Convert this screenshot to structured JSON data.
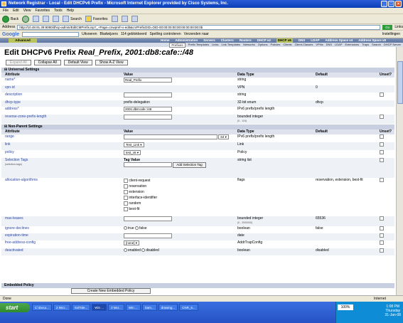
{
  "window": {
    "title": "Network Registrar - Local - Edit DHCPv6 Prefix - Microsoft Internet Explorer provided by Cisco Systems, Inc."
  },
  "menu": [
    "File",
    "Edit",
    "View",
    "Favorites",
    "Tools",
    "Help"
  ],
  "toolbar": {
    "back": "Back",
    "search": "Search",
    "favorites": "Favorites"
  },
  "address": {
    "label": "Address",
    "url": "http://10.48.91.39:8080/dhcp-admin/EditCMPrefix.isp?_+Page=cnwpref+x-edit&cnrPrefixOID=OID-00:00:00:00:00:00:00:00:00:0b",
    "go": "Go",
    "links": "Links"
  },
  "google": {
    "logo": "Google",
    "search_btn": "Uitvoeren",
    "blocked": "114 geblokkeerd",
    "spelling": "Spelling controleren",
    "send": "Verzenden naar",
    "bookmarks": "Bladwijzers",
    "settings": "Instellingen"
  },
  "nav": {
    "advanced": "Advanced",
    "main": [
      "Home",
      "Administration",
      "Servers",
      "Clusters",
      "Routers",
      "DHCP v4",
      "DHCP v6",
      "DNS",
      "LDAP",
      "Address Space v4",
      "Address Space v6"
    ],
    "sub": [
      "Prefixes",
      "Prefix Templates",
      "Links",
      "Link Templates",
      "Networks",
      "Options",
      "Policies",
      "Clients",
      "Client-Classes",
      "VPNs",
      "DNS",
      "LDAP",
      "Extensions",
      "Traps",
      "Search",
      "DHCP Server"
    ]
  },
  "page": {
    "heading_prefix": "Edit DHCPv6 Prefix ",
    "heading_name": "Real_Prefix, 2001:db8:cafe::/48"
  },
  "buttons": {
    "expand": "Expand All",
    "collapse": "Collapse All",
    "default_view": "Default View",
    "show_az": "Show A-Z View"
  },
  "universal": {
    "title": "Universal Settings",
    "headers": [
      "Attribute",
      "Value",
      "Data Type",
      "Default",
      "Unset?"
    ],
    "rows": [
      {
        "attr": "name*",
        "value": "Real_Prefix",
        "type": "string",
        "default": ""
      },
      {
        "attr": "vpn-id",
        "value": "",
        "type": "VPN",
        "default": "0"
      },
      {
        "attr": "description",
        "value": "",
        "type": "string",
        "default": ""
      },
      {
        "attr": "dhcp-type",
        "value": "prefix-delegation",
        "type": "32-bit enum",
        "default": "dhcp"
      },
      {
        "attr": "address*",
        "value": "2001:db8:cafe::/48",
        "type": "IPv6 prefix/prefix length",
        "default": ""
      },
      {
        "attr": "reverse-zone-prefix-length",
        "value": "",
        "type": "bounded integer",
        "type_note": "(0 - 124)",
        "default": ""
      }
    ]
  },
  "nonparent": {
    "title": "Non-Parent Settings",
    "headers": [
      "Attribute",
      "Value",
      "Data Type",
      "Default",
      "Unset?"
    ],
    "range": {
      "attr": "range",
      "prefix_len": "64",
      "type": "IPv6 prefix/prefix length"
    },
    "link": {
      "attr": "link",
      "value": "Test_Link",
      "type": "Link"
    },
    "policy": {
      "attr": "policy",
      "value": "test_v6",
      "type": "Policy"
    },
    "selection_tags": {
      "attr": "Selection Tags",
      "note": "(selection-tags)",
      "tag_value_label": "Tag Value",
      "add_btn": "Add Selection Tag",
      "type": "string list"
    },
    "allocation": {
      "attr": "allocation-algorithms",
      "options": [
        "client-request",
        "reservation",
        "extension",
        "interface-identifier",
        "random",
        "best-fit"
      ],
      "type": "flags",
      "default": "reservation, extension, best-fit"
    },
    "max_leases": {
      "attr": "max-leases",
      "type": "bounded integer",
      "type_note": "(0 - 2000000)",
      "default": "65536"
    },
    "ignore_declines": {
      "attr": "ignore-declines",
      "opt_true": "true",
      "opt_false": "false",
      "type": "boolean",
      "default": "false"
    },
    "expiration": {
      "attr": "expiration-time",
      "type": "date"
    },
    "free_addr": {
      "attr": "free-address-config",
      "value": "[none]",
      "type": "AddrTrapConfig"
    },
    "deactivated": {
      "attr": "deactivated",
      "opt_enabled": "enabled",
      "opt_disabled": "disabled",
      "type": "boolean",
      "default": "disabled"
    }
  },
  "embedded": {
    "title": "Embedded Policy",
    "create_btn": "Create New Embedded Policy"
  },
  "status": {
    "left": "Done",
    "zone": "Internet"
  },
  "taskbar": {
    "start": "start",
    "tasks": [
      "C:\\Docu...",
      "2 Micr...",
      "SolTole...",
      "Win ...",
      "2 Mcr...",
      "Win ...",
      "Sam...",
      "drawing...",
      "CNR_5..."
    ],
    "zoom": "100%",
    "time": "1:08 PM",
    "day": "Thursday",
    "date": "31-Jan-08"
  }
}
